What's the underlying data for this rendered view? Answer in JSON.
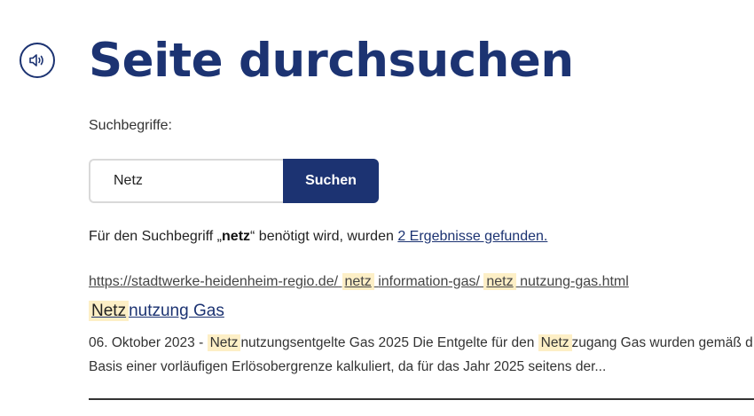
{
  "page": {
    "title": "Seite durchsuchen",
    "audio_icon": "speaker-icon",
    "brand_color": "#1c3372"
  },
  "search": {
    "label": "Suchbegriffe:",
    "value": "Netz",
    "button_label": "Suchen"
  },
  "summary": {
    "prefix": "Für den Suchbegriff „",
    "term": "netz",
    "middle": "“ benötigt wird, wurden ",
    "count_link": "2 Ergebnisse gefunden."
  },
  "results": [
    {
      "url_parts": [
        "https://stadtwerke-heidenheim-regio.de/",
        "netz",
        "information-gas/",
        "netz",
        "nutzung-gas.html"
      ],
      "title_parts": [
        "Netz",
        "nutzung Gas"
      ],
      "date": "06. Oktober 2023 - ",
      "snippet_line1_parts": [
        "Netz",
        "nutzungsentgelte Gas 2025 Die Entgelte für den ",
        "Netz",
        "zugang Gas wurden gemäß d"
      ],
      "snippet_line2": "Basis einer vorläufigen Erlösobergrenze kalkuliert, da für das Jahr 2025 seitens der..."
    }
  ]
}
